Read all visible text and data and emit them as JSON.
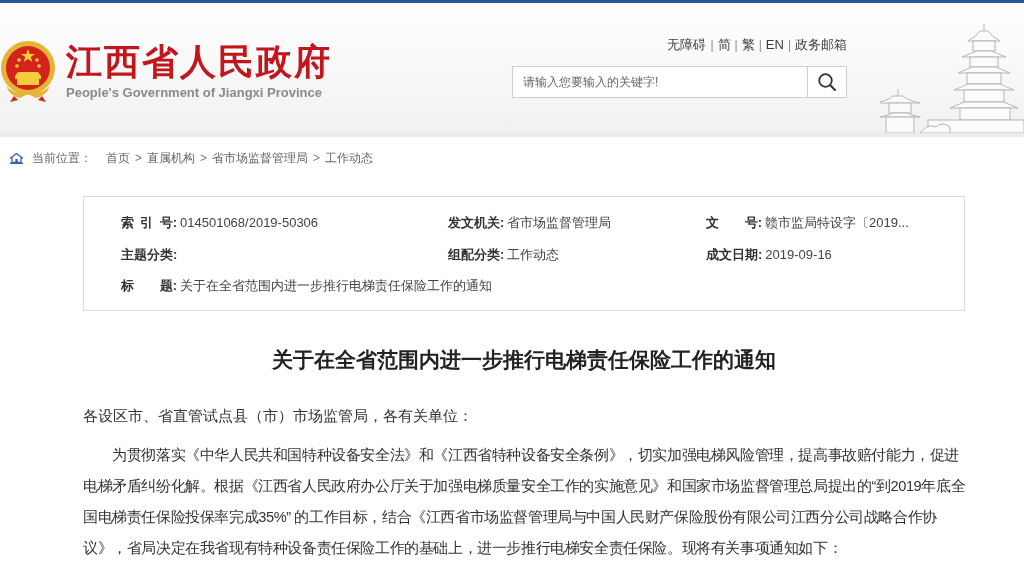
{
  "header": {
    "site_title": "江西省人民政府",
    "site_subtitle": "People's Government of Jiangxi Province",
    "top_links": [
      {
        "kind": "link",
        "text": "无障碍"
      },
      {
        "kind": "separator",
        "text": "|"
      },
      {
        "kind": "link",
        "text": "简"
      },
      {
        "kind": "separator",
        "text": "|"
      },
      {
        "kind": "link",
        "text": "繁"
      },
      {
        "kind": "separator",
        "text": "|"
      },
      {
        "kind": "link",
        "text": "EN"
      },
      {
        "kind": "separator",
        "text": "|"
      },
      {
        "kind": "link",
        "text": "政务邮箱"
      }
    ],
    "search": {
      "placeholder": "请输入您要输入的关键字!"
    }
  },
  "breadcrumb": {
    "label": "当前位置：",
    "items": [
      {
        "kind": "link",
        "text": "首页"
      },
      {
        "kind": "separator",
        "text": ">"
      },
      {
        "kind": "link",
        "text": "直属机构"
      },
      {
        "kind": "separator",
        "text": ">"
      },
      {
        "kind": "link",
        "text": "省市场监督管理局"
      },
      {
        "kind": "separator",
        "text": ">"
      },
      {
        "kind": "link",
        "text": "工作动态"
      }
    ]
  },
  "info": {
    "rows": [
      [
        {
          "label": "索 引 号:",
          "value": "014501068/2019-50306"
        },
        {
          "label": "发文机关:",
          "value": "省市场监督管理局"
        },
        {
          "label": "文 号:",
          "value": "赣市监局特设字〔2019..."
        }
      ],
      [
        {
          "label": "主题分类:"
        },
        {
          "label": "组配分类:",
          "value": "工作动态"
        },
        {
          "label": "成文日期:",
          "value": "2019-09-16"
        }
      ],
      [
        {
          "label": "标 题:",
          "value": "关于在全省范围内进一步推行电梯责任保险工作的通知"
        }
      ]
    ]
  },
  "article": {
    "title": "关于在全省范围内进一步推行电梯责任保险工作的通知",
    "salutation": "各设区市、省直管试点县（市）市场监管局，各有关单位：",
    "paragraphs": [
      "为贯彻落实《中华人民共和国特种设备安全法》和《江西省特种设备安全条例》，切实加强电梯风险管理，提高事故赔付能力，促进电梯矛盾纠纷化解。根据《江西省人民政府办公厅关于加强电梯质量安全工作的实施意见》和国家市场监督管理总局提出的“到2019年底全国电梯责任保险投保率完成35%” 的工作目标，结合《江西省市场监督管理局与中国人民财产保险股份有限公司江西分公司战略合作协议》，省局决定在我省现有特种设备责任保险工作的基础上，进一步推行电梯安全责任保险。现将有关事项通知如下："
    ]
  }
}
